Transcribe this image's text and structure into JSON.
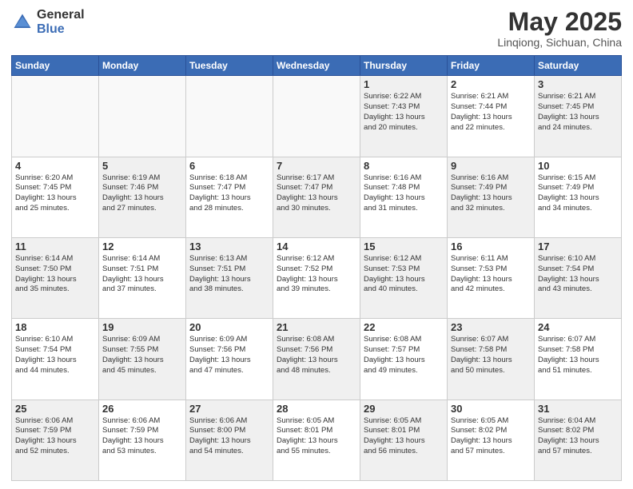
{
  "header": {
    "logo_general": "General",
    "logo_blue": "Blue",
    "month_title": "May 2025",
    "subtitle": "Linqiong, Sichuan, China"
  },
  "weekdays": [
    "Sunday",
    "Monday",
    "Tuesday",
    "Wednesday",
    "Thursday",
    "Friday",
    "Saturday"
  ],
  "weeks": [
    [
      {
        "day": "",
        "content": ""
      },
      {
        "day": "",
        "content": ""
      },
      {
        "day": "",
        "content": ""
      },
      {
        "day": "",
        "content": ""
      },
      {
        "day": "1",
        "content": "Sunrise: 6:22 AM\nSunset: 7:43 PM\nDaylight: 13 hours\nand 20 minutes."
      },
      {
        "day": "2",
        "content": "Sunrise: 6:21 AM\nSunset: 7:44 PM\nDaylight: 13 hours\nand 22 minutes."
      },
      {
        "day": "3",
        "content": "Sunrise: 6:21 AM\nSunset: 7:45 PM\nDaylight: 13 hours\nand 24 minutes."
      }
    ],
    [
      {
        "day": "4",
        "content": "Sunrise: 6:20 AM\nSunset: 7:45 PM\nDaylight: 13 hours\nand 25 minutes."
      },
      {
        "day": "5",
        "content": "Sunrise: 6:19 AM\nSunset: 7:46 PM\nDaylight: 13 hours\nand 27 minutes."
      },
      {
        "day": "6",
        "content": "Sunrise: 6:18 AM\nSunset: 7:47 PM\nDaylight: 13 hours\nand 28 minutes."
      },
      {
        "day": "7",
        "content": "Sunrise: 6:17 AM\nSunset: 7:47 PM\nDaylight: 13 hours\nand 30 minutes."
      },
      {
        "day": "8",
        "content": "Sunrise: 6:16 AM\nSunset: 7:48 PM\nDaylight: 13 hours\nand 31 minutes."
      },
      {
        "day": "9",
        "content": "Sunrise: 6:16 AM\nSunset: 7:49 PM\nDaylight: 13 hours\nand 32 minutes."
      },
      {
        "day": "10",
        "content": "Sunrise: 6:15 AM\nSunset: 7:49 PM\nDaylight: 13 hours\nand 34 minutes."
      }
    ],
    [
      {
        "day": "11",
        "content": "Sunrise: 6:14 AM\nSunset: 7:50 PM\nDaylight: 13 hours\nand 35 minutes."
      },
      {
        "day": "12",
        "content": "Sunrise: 6:14 AM\nSunset: 7:51 PM\nDaylight: 13 hours\nand 37 minutes."
      },
      {
        "day": "13",
        "content": "Sunrise: 6:13 AM\nSunset: 7:51 PM\nDaylight: 13 hours\nand 38 minutes."
      },
      {
        "day": "14",
        "content": "Sunrise: 6:12 AM\nSunset: 7:52 PM\nDaylight: 13 hours\nand 39 minutes."
      },
      {
        "day": "15",
        "content": "Sunrise: 6:12 AM\nSunset: 7:53 PM\nDaylight: 13 hours\nand 40 minutes."
      },
      {
        "day": "16",
        "content": "Sunrise: 6:11 AM\nSunset: 7:53 PM\nDaylight: 13 hours\nand 42 minutes."
      },
      {
        "day": "17",
        "content": "Sunrise: 6:10 AM\nSunset: 7:54 PM\nDaylight: 13 hours\nand 43 minutes."
      }
    ],
    [
      {
        "day": "18",
        "content": "Sunrise: 6:10 AM\nSunset: 7:54 PM\nDaylight: 13 hours\nand 44 minutes."
      },
      {
        "day": "19",
        "content": "Sunrise: 6:09 AM\nSunset: 7:55 PM\nDaylight: 13 hours\nand 45 minutes."
      },
      {
        "day": "20",
        "content": "Sunrise: 6:09 AM\nSunset: 7:56 PM\nDaylight: 13 hours\nand 47 minutes."
      },
      {
        "day": "21",
        "content": "Sunrise: 6:08 AM\nSunset: 7:56 PM\nDaylight: 13 hours\nand 48 minutes."
      },
      {
        "day": "22",
        "content": "Sunrise: 6:08 AM\nSunset: 7:57 PM\nDaylight: 13 hours\nand 49 minutes."
      },
      {
        "day": "23",
        "content": "Sunrise: 6:07 AM\nSunset: 7:58 PM\nDaylight: 13 hours\nand 50 minutes."
      },
      {
        "day": "24",
        "content": "Sunrise: 6:07 AM\nSunset: 7:58 PM\nDaylight: 13 hours\nand 51 minutes."
      }
    ],
    [
      {
        "day": "25",
        "content": "Sunrise: 6:06 AM\nSunset: 7:59 PM\nDaylight: 13 hours\nand 52 minutes."
      },
      {
        "day": "26",
        "content": "Sunrise: 6:06 AM\nSunset: 7:59 PM\nDaylight: 13 hours\nand 53 minutes."
      },
      {
        "day": "27",
        "content": "Sunrise: 6:06 AM\nSunset: 8:00 PM\nDaylight: 13 hours\nand 54 minutes."
      },
      {
        "day": "28",
        "content": "Sunrise: 6:05 AM\nSunset: 8:01 PM\nDaylight: 13 hours\nand 55 minutes."
      },
      {
        "day": "29",
        "content": "Sunrise: 6:05 AM\nSunset: 8:01 PM\nDaylight: 13 hours\nand 56 minutes."
      },
      {
        "day": "30",
        "content": "Sunrise: 6:05 AM\nSunset: 8:02 PM\nDaylight: 13 hours\nand 57 minutes."
      },
      {
        "day": "31",
        "content": "Sunrise: 6:04 AM\nSunset: 8:02 PM\nDaylight: 13 hours\nand 57 minutes."
      }
    ]
  ]
}
